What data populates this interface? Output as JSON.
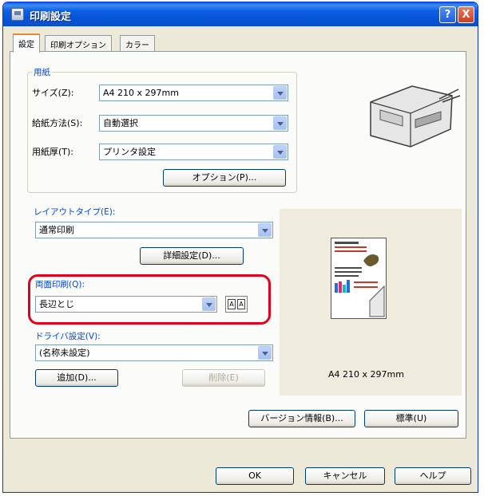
{
  "window": {
    "title": "印刷設定",
    "help": "?",
    "close": "X"
  },
  "tabs": [
    {
      "label": "設定"
    },
    {
      "label": "印刷オプション"
    },
    {
      "label": "カラー"
    }
  ],
  "paper_group": {
    "title": "用紙",
    "size_label": "サイズ(Z):",
    "size_value": "A4 210 x 297mm",
    "feed_label": "給紙方法(S):",
    "feed_value": "自動選択",
    "thickness_label": "用紙厚(T):",
    "thickness_value": "プリンタ設定",
    "options_button": "オプション(P)..."
  },
  "layout": {
    "label": "レイアウトタイプ(E):",
    "value": "通常印刷",
    "detail_button": "詳細設定(D)..."
  },
  "duplex": {
    "label": "両面印刷(Q):",
    "value": "長辺とじ",
    "icon_left": "A",
    "icon_right": "A"
  },
  "driver_settings": {
    "label": "ドライバ設定(V):",
    "value": "(名称未設定)",
    "add_button": "追加(D)...",
    "delete_button": "削除(E)"
  },
  "preview": {
    "size_text": "A4 210 x 297mm"
  },
  "bottom_buttons": {
    "version": "バージョン情報(B)...",
    "default": "標準(U)"
  },
  "dialog_buttons": {
    "ok": "OK",
    "cancel": "キャンセル",
    "help": "ヘルプ"
  },
  "colors": {
    "title_bar": "#0654d8",
    "group_label": "#0046d5",
    "highlight": "#e3001f"
  }
}
